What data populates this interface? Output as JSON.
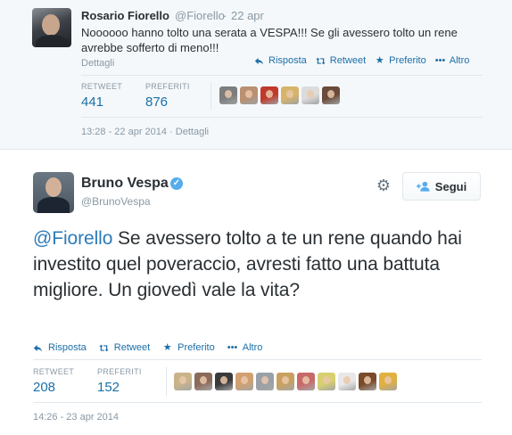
{
  "parent_tweet": {
    "name": "Rosario Fiorello",
    "handle": "@Fiorello",
    "separator": "·",
    "time": "22 apr",
    "text": "Noooooo hanno tolto una serata a VESPA!!! Se gli avessero tolto un rene avrebbe sofferto di meno!!!",
    "details_link": "Dettagli",
    "actions": {
      "reply": "Risposta",
      "retweet": "Retweet",
      "favorite": "Preferito",
      "more": "Altro"
    },
    "stats": {
      "retweet_label": "RETWEET",
      "retweet_count": "441",
      "favorites_label": "PREFERITI",
      "favorites_count": "876"
    },
    "favoriters_colors": [
      "#7d7d7d",
      "#b99070",
      "#c0392b",
      "#d8b46a",
      "#dcdcdc",
      "#6a4a3a"
    ],
    "footer": "13:28 - 22 apr 2014 · Dettagli"
  },
  "main_tweet": {
    "name": "Bruno Vespa",
    "verified_glyph": "✓",
    "handle": "@BrunoVespa",
    "follow_label": "Segui",
    "mention": "@Fiorello",
    "text": " Se avessero tolto a te un rene quando hai investito quel poveraccio, avresti fatto una battuta migliore. Un giovedì vale la vita?",
    "actions": {
      "reply": "Risposta",
      "retweet": "Retweet",
      "favorite": "Preferito",
      "more": "Altro"
    },
    "stats": {
      "retweet_label": "RETWEET",
      "retweet_count": "208",
      "favorites_label": "PREFERITI",
      "favorites_count": "152"
    },
    "favoriters_colors": [
      "#c9b48a",
      "#8a6a5a",
      "#3a3a3a",
      "#d1a070",
      "#9aa0a8",
      "#c8a060",
      "#c86a6a",
      "#d8d070",
      "#e8e8e8",
      "#7a4a2a",
      "#e0b040"
    ],
    "footer": "14:26 - 23 apr 2014"
  },
  "icons": {
    "reply": "reply-icon",
    "retweet": "retweet-icon",
    "favorite": "star-icon",
    "more": "more-icon",
    "gear": "gear-icon",
    "follow": "add-user-icon"
  },
  "colors": {
    "link": "#1b6fa8",
    "mention": "#2b7bb9",
    "muted": "#8899a6",
    "verified": "#55acee"
  }
}
